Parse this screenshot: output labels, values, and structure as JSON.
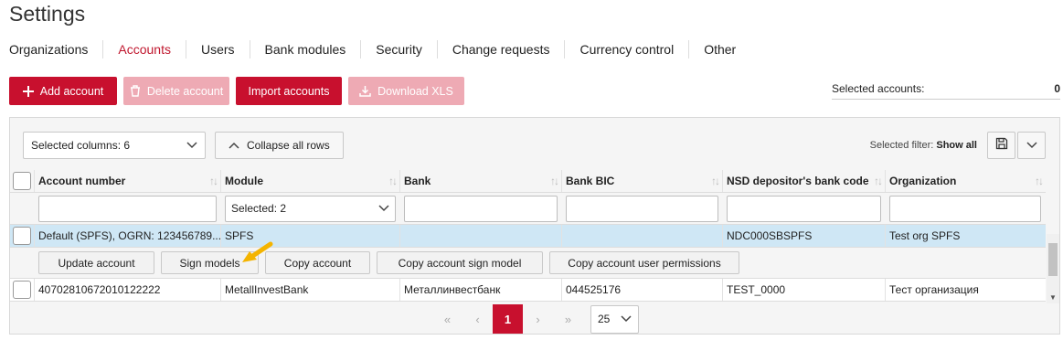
{
  "page": {
    "title": "Settings"
  },
  "tabs": [
    {
      "label": "Organizations",
      "active": false
    },
    {
      "label": "Accounts",
      "active": true
    },
    {
      "label": "Users",
      "active": false
    },
    {
      "label": "Bank modules",
      "active": false
    },
    {
      "label": "Security",
      "active": false
    },
    {
      "label": "Change requests",
      "active": false
    },
    {
      "label": "Currency control",
      "active": false
    },
    {
      "label": "Other",
      "active": false
    }
  ],
  "toolbar": {
    "add_account": "Add account",
    "delete_account": "Delete account",
    "import_accounts": "Import accounts",
    "download_xls": "Download XLS"
  },
  "selected_accounts": {
    "label": "Selected accounts:",
    "value": "0"
  },
  "panel": {
    "selected_columns": "Selected columns: 6",
    "collapse_all_rows": "Collapse all rows",
    "filter_label": "Selected filter:",
    "filter_value": "Show all"
  },
  "columns": [
    "Account number",
    "Module",
    "Bank",
    "Bank BIC",
    "NSD depositor's bank code",
    "Organization"
  ],
  "filters": {
    "account_number": "",
    "module": "Selected: 2",
    "bank": "",
    "bank_bic": "",
    "nsd_code": "",
    "organization": ""
  },
  "rows": [
    {
      "account_number": "Default (SPFS), OGRN: 123456789...",
      "module": "SPFS",
      "bank": "",
      "bank_bic": "",
      "nsd_code": "NDC000SBSPFS",
      "organization": "Test org SPFS"
    },
    {
      "account_number": "40702810672010122222",
      "module": "MetallInvestBank",
      "bank": "Металлинвестбанк",
      "bank_bic": "044525176",
      "nsd_code": "TEST_0000",
      "organization": "Тест организация"
    }
  ],
  "row_actions": {
    "update_account": "Update account",
    "sign_models": "Sign models",
    "copy_account": "Copy account",
    "copy_account_sign_model": "Copy account sign model",
    "copy_account_user_permissions": "Copy account user permissions"
  },
  "pagination": {
    "first": "«",
    "prev": "‹",
    "current_page": "1",
    "next": "›",
    "last": "»",
    "page_size": "25"
  },
  "colors": {
    "brand": "#c8102e",
    "active_tab": "#c0172e",
    "selected_row": "#cfe7f5",
    "arrow": "#f4b400"
  }
}
